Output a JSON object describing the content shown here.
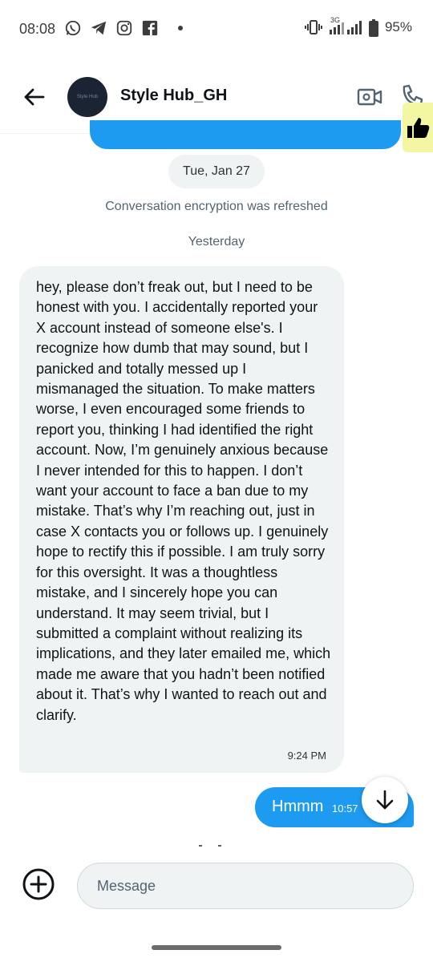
{
  "status_bar": {
    "time": "08:08",
    "battery": "95%",
    "network": "3G",
    "icons": [
      "whatsapp-icon",
      "telegram-icon",
      "instagram-icon",
      "facebook-icon",
      "notification-dot",
      "vibrate-icon",
      "signal-icon",
      "signal-icon",
      "battery-icon"
    ]
  },
  "header": {
    "contact_name": "Style Hub_GH",
    "avatar_text": "Style Hub"
  },
  "conversation": {
    "date_pill": "Tue, Jan 27",
    "system_note": "Conversation encryption was refreshed",
    "day_label": "Yesterday",
    "received_message": {
      "text": "hey, please don’t freak out, but I need to be honest with you. I accidentally reported your X account instead of someone else's. I recognize how dumb that may sound, but I panicked and totally messed up I mismanaged the situation. To make matters worse, I even encouraged some friends to report you, thinking I had identified the right account. Now, I’m genuinely anxious because I never intended for this to happen. I don’t want your account to face a ban due to my mistake. That’s why I’m reaching out, just in case X contacts you or follows up. I genuinely hope to rectify this if possible. I am truly sorry for this oversight. It was a thoughtless mistake, and I sincerely hope you can understand. It may seem trivial, but I submitted a complaint without realizing its implications, and they later emailed me, which made me aware that you hadn’t been notified about it. That’s why I wanted to reach out and clarify.",
      "time": "9:24 PM"
    },
    "sent_message": {
      "text": "Hmmm",
      "time": "10:57"
    }
  },
  "composer": {
    "placeholder": "Message",
    "value": ""
  },
  "colors": {
    "accent": "#1d9bf0",
    "bubble_received": "#eff3f4",
    "highlight": "#f4f7a1"
  }
}
